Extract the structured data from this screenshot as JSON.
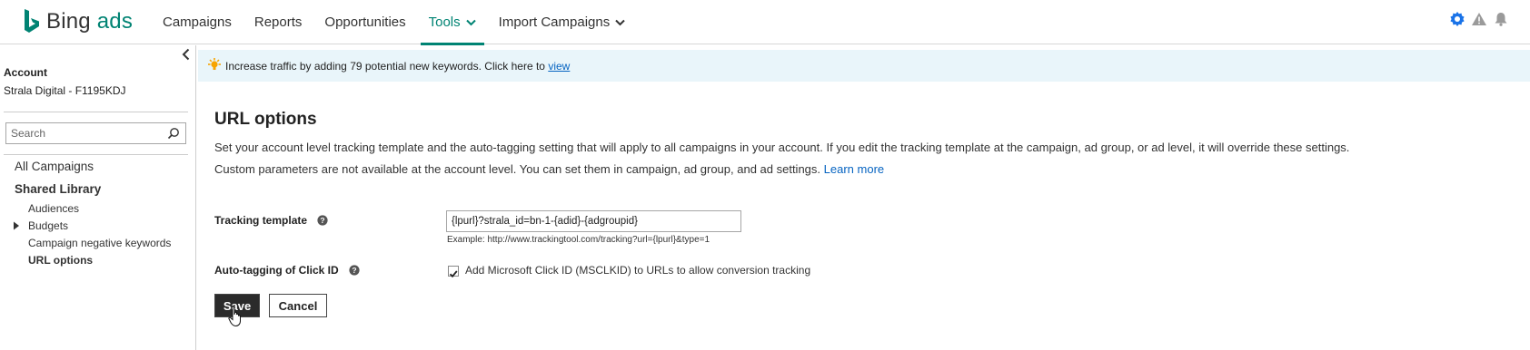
{
  "header": {
    "logo_brand": "Bing",
    "logo_product": "ads",
    "nav": [
      {
        "label": "Campaigns",
        "active": false,
        "has_dropdown": false
      },
      {
        "label": "Reports",
        "active": false,
        "has_dropdown": false
      },
      {
        "label": "Opportunities",
        "active": false,
        "has_dropdown": false
      },
      {
        "label": "Tools",
        "active": true,
        "has_dropdown": true
      },
      {
        "label": "Import Campaigns",
        "active": false,
        "has_dropdown": true
      }
    ],
    "icons": [
      "settings-badge-icon",
      "warning-icon",
      "notification-bell-icon"
    ]
  },
  "sidebar": {
    "account_label": "Account",
    "account_name": "Strala Digital - F1195KDJ",
    "search_placeholder": "Search",
    "all_campaigns": "All Campaigns",
    "shared_library": "Shared Library",
    "items": [
      {
        "label": "Audiences"
      },
      {
        "label": "Budgets",
        "expandable": true
      },
      {
        "label": "Campaign negative keywords"
      },
      {
        "label": "URL options",
        "selected": true
      }
    ]
  },
  "banner": {
    "text": "Increase traffic by adding 79 potential new keywords. Click here to",
    "link": "view"
  },
  "main": {
    "title": "URL options",
    "description_line1": "Set your account level tracking template and the auto-tagging setting that will apply to all campaigns in your account. If you edit the tracking template at the campaign, ad group, or ad level, it will override these settings.",
    "description_line2": "Custom parameters are not available at the account level. You can set them in campaign, ad group, and ad settings.",
    "learn_more": "Learn more",
    "tracking_template_label": "Tracking template",
    "tracking_template_value": "{lpurl}?strala_id=bn-1-{adid}-{adgroupid}",
    "tracking_example": "Example: http://www.trackingtool.com/tracking?url={lpurl}&type=1",
    "auto_tagging_label": "Auto-tagging of Click ID",
    "auto_tagging_checkbox_label": "Add Microsoft Click ID (MSCLKID) to URLs to allow conversion tracking",
    "auto_tagging_checked": true,
    "save_label": "Save",
    "cancel_label": "Cancel"
  },
  "colors": {
    "accent": "#008373",
    "banner_bg": "#e9f5fa",
    "link": "#0563c1",
    "save_bg": "#2b2b2b"
  }
}
